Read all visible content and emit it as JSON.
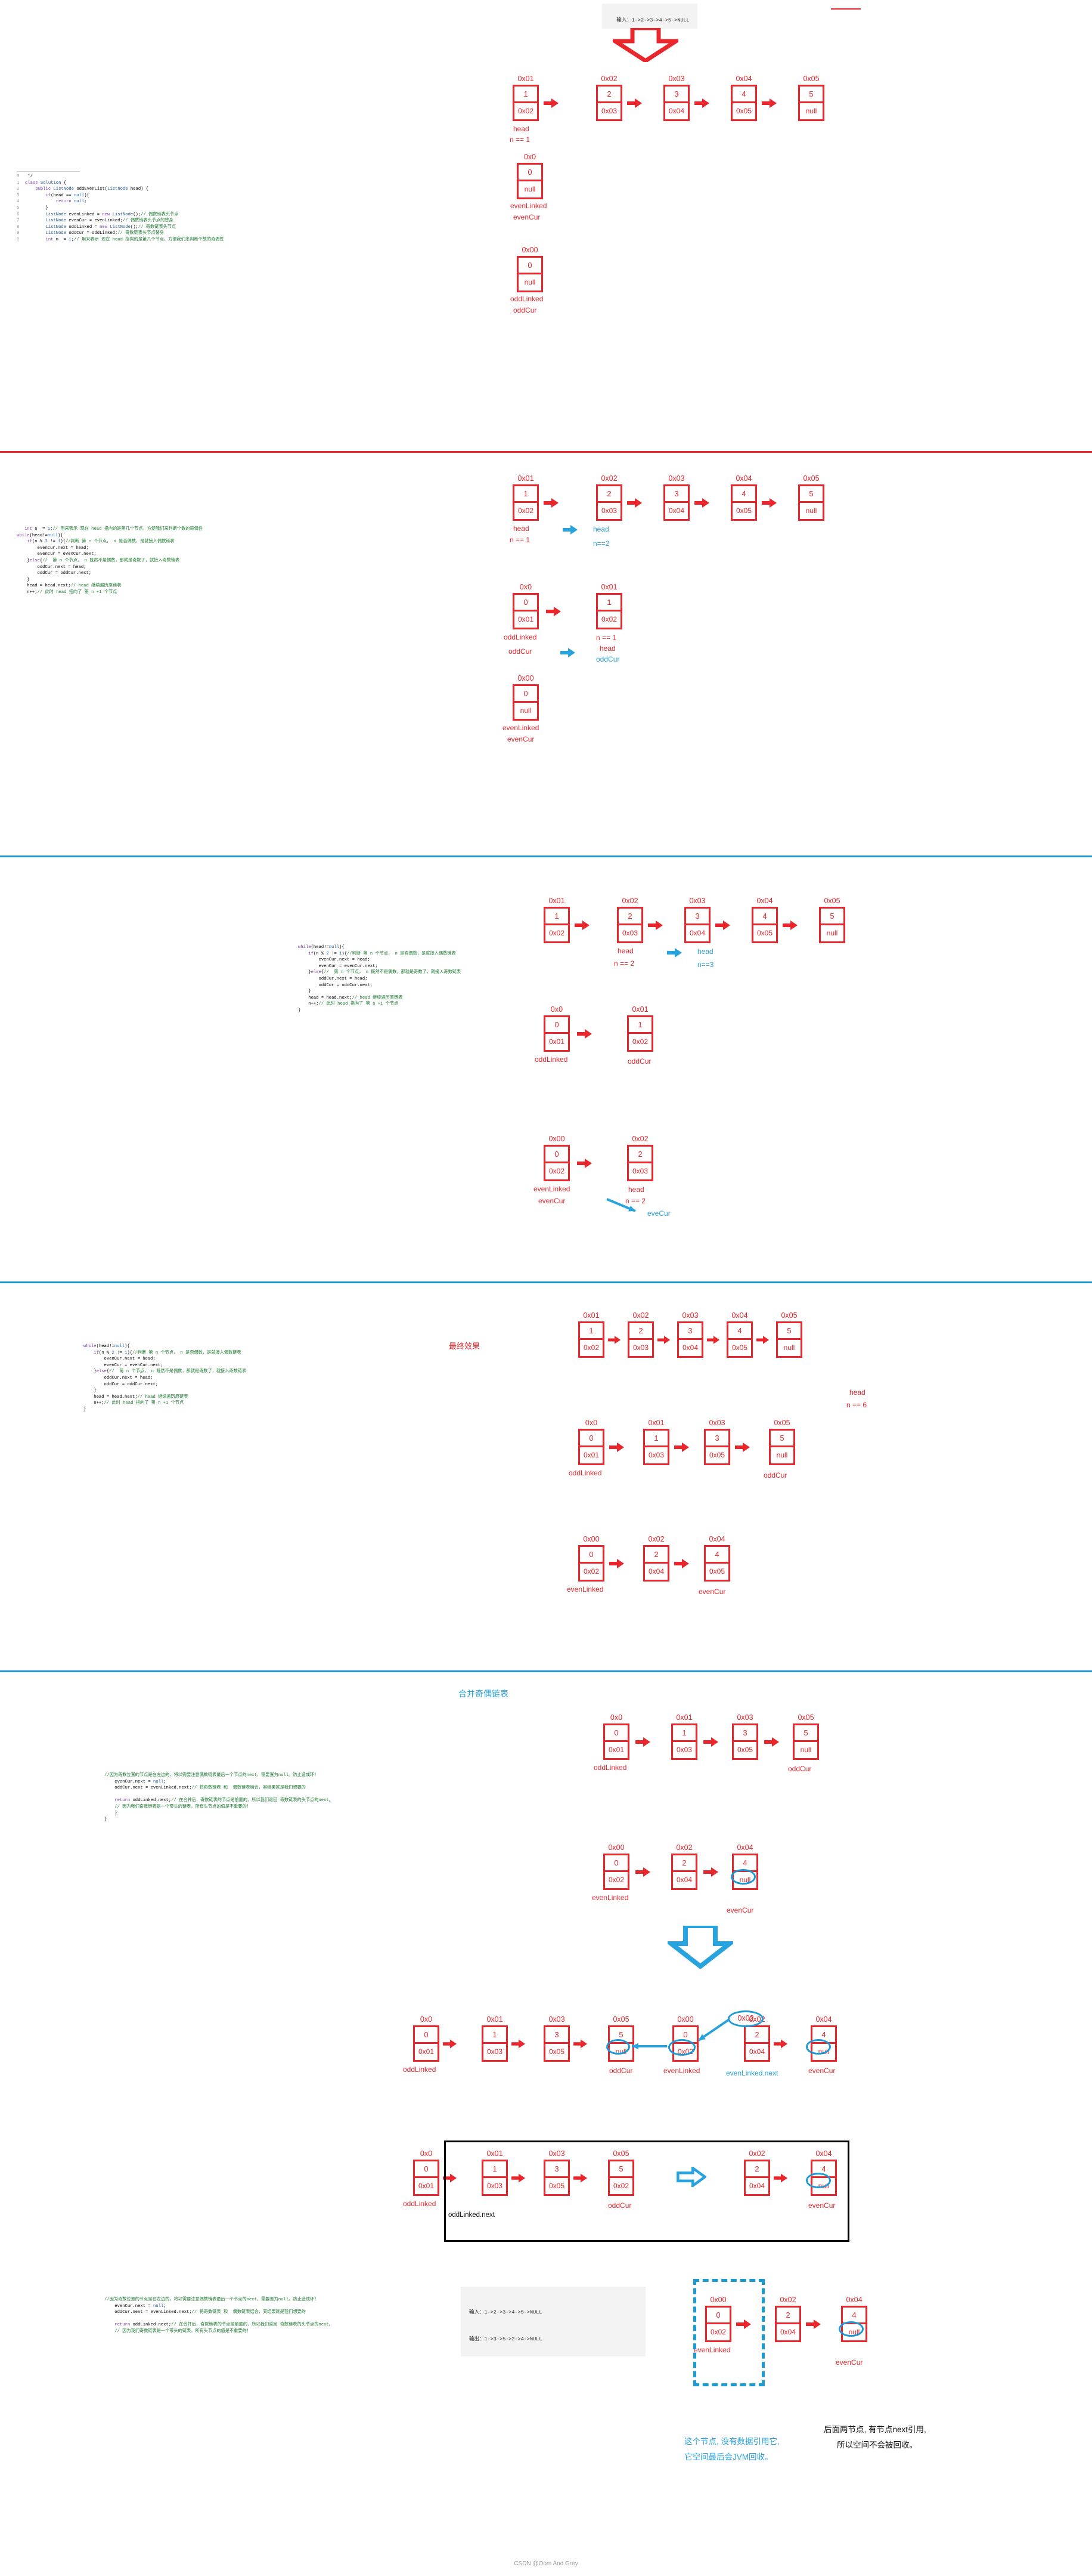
{
  "meta": {
    "footer": "CSDN @Oom And Grey"
  },
  "io": {
    "top_input": "输入：1->2->3->4->5->NULL",
    "bottom_input": "输入：1->2->3->4->5->NULL",
    "bottom_output": "输出：1->3->5->2->4->NULL"
  },
  "code_blocks": {
    "block1": [
      {
        "ln": "0",
        "text": " */"
      },
      {
        "ln": "1",
        "text": "class Solution {"
      },
      {
        "ln": "2",
        "text": "    public ListNode oddEvenList(ListNode head) {"
      },
      {
        "ln": "3",
        "text": "        if(head == null){"
      },
      {
        "ln": "4",
        "text": "            return null;"
      },
      {
        "ln": "5",
        "text": "        }"
      },
      {
        "ln": "6",
        "text": "        ListNode evenLinked = new ListNode();// 偶数链表头节点"
      },
      {
        "ln": "7",
        "text": "        ListNode evenCur = evenLinked;// 偶数链表头节点的替身"
      },
      {
        "ln": "8",
        "text": "        ListNode oddLinked = new ListNode();// 奇数链表头节点"
      },
      {
        "ln": "9",
        "text": "        ListNode oddCur = oddLinked;// 奇数链表头节点替身"
      },
      {
        "ln": "0",
        "text": "        int n  = 1;// 用来表示 现在 head 指向的是第几个节点，方便我们来判断个数的奇偶性"
      }
    ],
    "block2": [
      {
        "ln": "",
        "text": "   int n  = 1;// 用来表示 现在 head 指向的是第几个节点，方便我们来判断个数的奇偶性"
      },
      {
        "ln": "",
        "text": "while(head!=null){"
      },
      {
        "ln": "",
        "text": "    if(n % 2 != 1){//判断 第 n 个节点， n 是否偶数，是就接入偶数链表"
      },
      {
        "ln": "",
        "text": "        evenCur.next = head;"
      },
      {
        "ln": "",
        "text": "        evenCur = evenCur.next;"
      },
      {
        "ln": "",
        "text": "    }else{//  第 n 个节点， n 既然不是偶数，那就是奇数了，就接入奇数链表"
      },
      {
        "ln": "",
        "text": "        oddCur.next = head;"
      },
      {
        "ln": "",
        "text": "        oddCur = oddCur.next;"
      },
      {
        "ln": "",
        "text": "    }"
      },
      {
        "ln": "",
        "text": "    head = head.next;// head 继续遍历原链表"
      },
      {
        "ln": "",
        "text": "    n++;// 此时 head 指向了 第 n +1 个节点"
      }
    ],
    "block3": [
      {
        "ln": "",
        "text": "while(head!=null){"
      },
      {
        "ln": "",
        "text": "    if(n % 2 != 1){//判断 第 n 个节点， n 是否偶数，是就接入偶数链表"
      },
      {
        "ln": "",
        "text": "        evenCur.next = head;"
      },
      {
        "ln": "",
        "text": "        evenCur = evenCur.next;"
      },
      {
        "ln": "",
        "text": "    }else{//  第 n 个节点， n 既然不是偶数，那就是奇数了，就接入奇数链表"
      },
      {
        "ln": "",
        "text": "        oddCur.next = head;"
      },
      {
        "ln": "",
        "text": "        oddCur = oddCur.next;"
      },
      {
        "ln": "",
        "text": "    }"
      },
      {
        "ln": "",
        "text": "    head = head.next;// head 继续遍历原链表"
      },
      {
        "ln": "",
        "text": "    n++;// 此时 head 指向了 第 n +1 个节点"
      },
      {
        "ln": "",
        "text": "}"
      }
    ],
    "block4": [
      {
        "ln": "",
        "text": "while(head!=null){"
      },
      {
        "ln": "",
        "text": "    if(n % 2 != 1){//判断 第 n 个节点， n 是否偶数，是就接入偶数链表"
      },
      {
        "ln": "",
        "text": "        evenCur.next = head;"
      },
      {
        "ln": "",
        "text": "        evenCur = evenCur.next;"
      },
      {
        "ln": "",
        "text": "    }else{//  第 n 个节点， n 既然不是偶数，那就是奇数了，就接入奇数链表"
      },
      {
        "ln": "",
        "text": "        oddCur.next = head;"
      },
      {
        "ln": "",
        "text": "        oddCur = oddCur.next;"
      },
      {
        "ln": "",
        "text": "    }"
      },
      {
        "ln": "",
        "text": "    head = head.next;// head 继续遍历原链表"
      },
      {
        "ln": "",
        "text": "    n++;// 此时 head 指向了 第 n +1 个节点"
      },
      {
        "ln": "",
        "text": "}"
      }
    ],
    "block5": [
      {
        "ln": "",
        "text": "//因为奇数位置的节点是在左边的，将以需要注意偶数链表最后一个节点的next，需要置为null。防止造成环！"
      },
      {
        "ln": "",
        "text": "    evenCur.next = null;"
      },
      {
        "ln": "",
        "text": "    oddCur.next = evenLinked.next;// 将奇数链表 和  偶数链表结合，其结果就是我们想要的"
      },
      {
        "ln": "",
        "text": ""
      },
      {
        "ln": "",
        "text": "    return oddLinked.next;// 在合并后，奇数链表的节点是前面的，所以我们返回 奇数链表的头节点的next。"
      },
      {
        "ln": "",
        "text": "    // 因为我们奇数链表是一个带头的链表，所有头节点的值是不重要的！"
      },
      {
        "ln": "",
        "text": "    }"
      },
      {
        "ln": "",
        "text": "}"
      }
    ],
    "block6": [
      {
        "ln": "",
        "text": "//因为奇数位置的节点是在左边的，将以需要注意偶数链表最后一个节点的next，需要置为null。防止造成环！"
      },
      {
        "ln": "",
        "text": "    evenCur.next = null;"
      },
      {
        "ln": "",
        "text": "    oddCur.next = evenLinked.next;// 将奇数链表 和  偶数链表结合，其结果就是我们想要的"
      },
      {
        "ln": "",
        "text": ""
      },
      {
        "ln": "",
        "text": "    return oddLinked.next;// 在合并后，奇数链表的节点是前面的，所以我们返回 奇数链表的头节点的next。"
      },
      {
        "ln": "",
        "text": "    // 因为我们奇数链表是一个带头的链表，所有头节点的值是不重要的！"
      }
    ]
  },
  "sections": {
    "s4_title": "最终效果",
    "s5_title": "合并奇偶链表"
  },
  "notes": {
    "jvm_recycle_line1": "这个节点, 没有数据引用它,",
    "jvm_recycle_line2": "它空间最后会JVM回收。",
    "keep_line1": "后面两节点, 有节点next引用,",
    "keep_line2": "所以空间不会被回收。"
  },
  "diagrams": {
    "s1_main": {
      "nodes": [
        {
          "addr": "0x01",
          "val": "1",
          "next": "0x02"
        },
        {
          "addr": "0x02",
          "val": "2",
          "next": "0x03"
        },
        {
          "addr": "0x03",
          "val": "3",
          "next": "0x04"
        },
        {
          "addr": "0x04",
          "val": "4",
          "next": "0x05"
        },
        {
          "addr": "0x05",
          "val": "5",
          "next": "null"
        }
      ],
      "head_label": "head",
      "n_label": "n == 1"
    },
    "s1_even": {
      "addr": "0x0",
      "val": "0",
      "next": "null",
      "l1": "evenLinked",
      "l2": "evenCur"
    },
    "s1_odd": {
      "addr": "0x00",
      "val": "0",
      "next": "null",
      "l1": "oddLinked",
      "l2": "oddCur"
    },
    "s2_main": {
      "nodes": [
        {
          "addr": "0x01",
          "val": "1",
          "next": "0x02"
        },
        {
          "addr": "0x02",
          "val": "2",
          "next": "0x03"
        },
        {
          "addr": "0x03",
          "val": "3",
          "next": "0x04"
        },
        {
          "addr": "0x04",
          "val": "4",
          "next": "0x05"
        },
        {
          "addr": "0x05",
          "val": "5",
          "next": "null"
        }
      ],
      "head_old": "head",
      "n_old": "n == 1",
      "head_new": "head",
      "n_new": "n==2"
    },
    "s2_odd": {
      "nodes": [
        {
          "addr": "0x0",
          "val": "0",
          "next": "0x01"
        },
        {
          "addr": "0x01",
          "val": "1",
          "next": "0x02"
        }
      ],
      "l1": "oddLinked",
      "l2": "oddCur",
      "r1": "n == 1",
      "r2": "head",
      "r3": "oddCur"
    },
    "s2_even": {
      "addr": "0x00",
      "val": "0",
      "next": "null",
      "l1": "evenLinked",
      "l2": "evenCur"
    },
    "s3_main": {
      "nodes": [
        {
          "addr": "0x01",
          "val": "1",
          "next": "0x02"
        },
        {
          "addr": "0x02",
          "val": "2",
          "next": "0x03"
        },
        {
          "addr": "0x03",
          "val": "3",
          "next": "0x04"
        },
        {
          "addr": "0x04",
          "val": "4",
          "next": "0x05"
        },
        {
          "addr": "0x05",
          "val": "5",
          "next": "null"
        }
      ],
      "head_old": "head",
      "n_old": "n == 2",
      "head_new": "head",
      "n_new": "n==3"
    },
    "s3_odd": {
      "nodes": [
        {
          "addr": "0x0",
          "val": "0",
          "next": "0x01"
        },
        {
          "addr": "0x01",
          "val": "1",
          "next": "0x02"
        }
      ],
      "l1": "oddLinked",
      "l2": "oddCur"
    },
    "s3_even": {
      "nodes": [
        {
          "addr": "0x00",
          "val": "0",
          "next": "0x02"
        },
        {
          "addr": "0x02",
          "val": "2",
          "next": "0x03"
        }
      ],
      "l1": "evenLinked",
      "l2": "evenCur",
      "r1": "head",
      "r2": "n == 2",
      "r3": "eveCur"
    },
    "s4_main": {
      "nodes": [
        {
          "addr": "0x01",
          "val": "1",
          "next": "0x02"
        },
        {
          "addr": "0x02",
          "val": "2",
          "next": "0x03"
        },
        {
          "addr": "0x03",
          "val": "3",
          "next": "0x04"
        },
        {
          "addr": "0x04",
          "val": "4",
          "next": "0x05"
        },
        {
          "addr": "0x05",
          "val": "5",
          "next": "null"
        }
      ],
      "head_label": "head",
      "n_label": "n == 6"
    },
    "s4_odd": {
      "nodes": [
        {
          "addr": "0x0",
          "val": "0",
          "next": "0x01"
        },
        {
          "addr": "0x01",
          "val": "1",
          "next": "0x03"
        },
        {
          "addr": "0x03",
          "val": "3",
          "next": "0x05"
        },
        {
          "addr": "0x05",
          "val": "5",
          "next": "null"
        }
      ],
      "l1": "oddLinked",
      "l2": "oddCur"
    },
    "s4_even": {
      "nodes": [
        {
          "addr": "0x00",
          "val": "0",
          "next": "0x02"
        },
        {
          "addr": "0x02",
          "val": "2",
          "next": "0x04"
        },
        {
          "addr": "0x04",
          "val": "4",
          "next": "0x05"
        }
      ],
      "l1": "evenLinked",
      "l2": "evenCur"
    },
    "s5_odd": {
      "nodes": [
        {
          "addr": "0x0",
          "val": "0",
          "next": "0x01"
        },
        {
          "addr": "0x01",
          "val": "1",
          "next": "0x03"
        },
        {
          "addr": "0x03",
          "val": "3",
          "next": "0x05"
        },
        {
          "addr": "0x05",
          "val": "5",
          "next": "null"
        }
      ],
      "l1": "oddLinked",
      "l2": "oddCur"
    },
    "s5_even": {
      "nodes": [
        {
          "addr": "0x00",
          "val": "0",
          "next": "0x02"
        },
        {
          "addr": "0x02",
          "val": "2",
          "next": "0x04"
        },
        {
          "addr": "0x04",
          "val": "4",
          "next": "null"
        }
      ],
      "l1": "evenLinked",
      "l2": "evenCur"
    },
    "s5_merged": {
      "nodes": [
        {
          "addr": "0x0",
          "val": "0",
          "next": "0x01"
        },
        {
          "addr": "0x01",
          "val": "1",
          "next": "0x03"
        },
        {
          "addr": "0x03",
          "val": "3",
          "next": "0x05"
        },
        {
          "addr": "0x05",
          "val": "5",
          "next": "null"
        },
        {
          "addr": "0x00",
          "val": "0",
          "next": "0x02"
        },
        {
          "addr": "0x02",
          "val": "2",
          "next": "0x04"
        },
        {
          "addr": "0x04",
          "val": "4",
          "next": "null"
        }
      ],
      "l_odd": "oddLinked",
      "l_oddcur": "oddCur",
      "l_even": "evenLinked",
      "l_evennext": "evenLinked.next",
      "l_evencur": "evenCur",
      "callout_addr": "0x02"
    },
    "s5_final": {
      "nodes": [
        {
          "addr": "0x0",
          "val": "0",
          "next": "0x01"
        },
        {
          "addr": "0x01",
          "val": "1",
          "next": "0x03"
        },
        {
          "addr": "0x03",
          "val": "3",
          "next": "0x05"
        },
        {
          "addr": "0x05",
          "val": "5",
          "next": "0x02"
        },
        {
          "addr": "0x02",
          "val": "2",
          "next": "0x04"
        },
        {
          "addr": "0x04",
          "val": "4",
          "next": "null"
        }
      ],
      "l_odd": "oddLinked",
      "l_oddnext": "oddLinked.next",
      "l_oddcur": "oddCur",
      "l_evencur": "evenCur"
    },
    "s5_gc": {
      "nodes": [
        {
          "addr": "0x00",
          "val": "0",
          "next": "0x02"
        },
        {
          "addr": "0x02",
          "val": "2",
          "next": "0x04"
        },
        {
          "addr": "0x04",
          "val": "4",
          "next": "null"
        }
      ],
      "l_even": "evenLinked",
      "l_evencur": "evenCur"
    }
  },
  "colors": {
    "red": "#e8262c",
    "blue": "#29a3dd",
    "black": "#111111"
  }
}
